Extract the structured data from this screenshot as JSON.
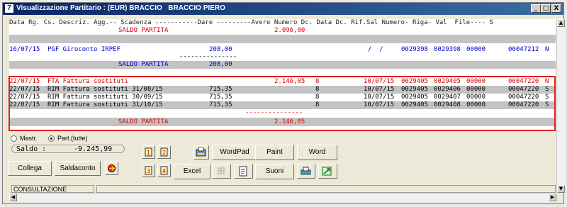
{
  "window": {
    "title": "Visualizzazione Partitario : (EUR) BRACCIO   BRACCIO PIERO",
    "app_icon": "7",
    "minimize": "_",
    "restore": "□",
    "close": "X"
  },
  "grid": {
    "header": "Data Rg. Cs. Descriz. Agg.-- Scadenza -----------Dare ---------Avere Numero Dc. Data Dc. Rif.Sal Numero- Riga- Val  File---- S",
    "rows": [
      {
        "saldo_label": "SALDO PARTITA",
        "avere": "2.096,00"
      },
      {
        "data": "16/07/15",
        "descr": "PGF Giroconto IRPEF",
        "dare": "208,00",
        "data_dc": "/  /",
        "rif": "0029398",
        "numero": "0029398",
        "riga": "00000",
        "file": "00047212",
        "s": "N"
      },
      {
        "sep": "---------------"
      },
      {
        "saldo_label": "SALDO PARTITA",
        "dare": "208,00"
      },
      {
        "data": "22/07/15",
        "descr": "FTA Fattura sostituti",
        "avere": "2.146,05",
        "numdc": "8",
        "data_dc": "10/07/15",
        "rif": "0029405",
        "numero": "0029405",
        "riga": "00000",
        "file": "00047220",
        "s": "N"
      },
      {
        "data": "22/07/15",
        "descr": "RIM Fattura sostituti 31/08/15",
        "dare": "715,35",
        "numdc": "8",
        "data_dc": "10/07/15",
        "rif": "0029405",
        "numero": "0029406",
        "riga": "00000",
        "file": "00047220",
        "s": "S"
      },
      {
        "data": "22/07/15",
        "descr": "RIM Fattura sostituti 30/09/15",
        "dare": "715,35",
        "numdc": "8",
        "data_dc": "10/07/15",
        "rif": "0029405",
        "numero": "0029407",
        "riga": "00000",
        "file": "00047220",
        "s": "S"
      },
      {
        "data": "22/07/15",
        "descr": "RIM Fattura sostituti 31/10/15",
        "dare": "715,35",
        "numdc": "8",
        "data_dc": "10/07/15",
        "rif": "0029405",
        "numero": "0029408",
        "riga": "00000",
        "file": "00047220",
        "s": "S"
      },
      {
        "sep2": "---------------"
      },
      {
        "saldo_label": "SALDO PARTITA",
        "avere": "2.146,05"
      }
    ]
  },
  "options": {
    "mastr": "Mastr.",
    "part": "Part.(tutte)"
  },
  "saldo": {
    "label": "Saldo :",
    "value": "-9.245,99"
  },
  "buttons": {
    "collega": "Collega",
    "saldaconto": "Saldaconto",
    "excel": "Excel",
    "wordpad": "WordPad",
    "paint": "Paint",
    "word": "Word",
    "suoni": "Suoni"
  },
  "status": {
    "mode": "CONSULTAZIONE"
  },
  "colors": {
    "red": "#dd0000",
    "blue": "#0000cc",
    "highlight_border": "#e02020",
    "title_bar": "#0a246a"
  }
}
